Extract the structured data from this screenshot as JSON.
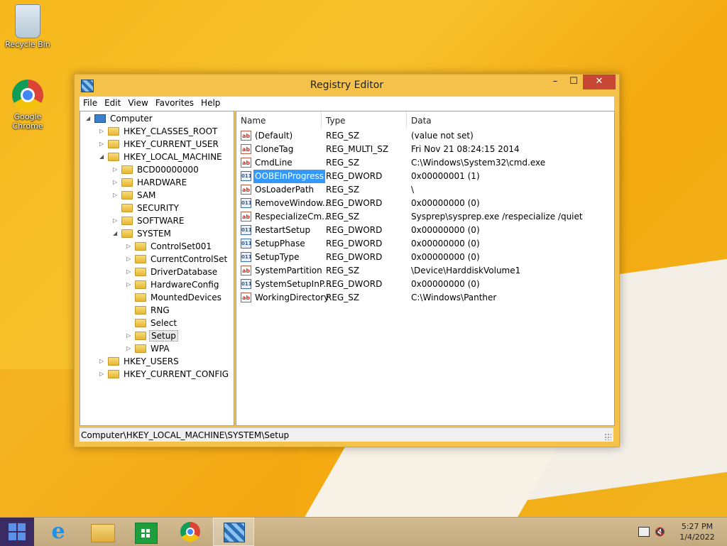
{
  "desktop": {
    "icons": [
      {
        "label": "Recycle Bin",
        "icon": "recycle-bin-icon"
      },
      {
        "label": "Google\nChrome",
        "icon": "chrome-icon"
      }
    ]
  },
  "window": {
    "title": "Registry Editor",
    "controls": {
      "minimize": "–",
      "maximize": "☐",
      "close": "✕"
    },
    "menu": [
      "File",
      "Edit",
      "View",
      "Favorites",
      "Help"
    ],
    "tree": [
      {
        "label": "Computer",
        "level": 0,
        "expander": "◢",
        "kind": "computer"
      },
      {
        "label": "HKEY_CLASSES_ROOT",
        "level": 1,
        "expander": "▷"
      },
      {
        "label": "HKEY_CURRENT_USER",
        "level": 1,
        "expander": "▷"
      },
      {
        "label": "HKEY_LOCAL_MACHINE",
        "level": 1,
        "expander": "◢"
      },
      {
        "label": "BCD00000000",
        "level": 2,
        "expander": "▷"
      },
      {
        "label": "HARDWARE",
        "level": 2,
        "expander": "▷"
      },
      {
        "label": "SAM",
        "level": 2,
        "expander": "▷"
      },
      {
        "label": "SECURITY",
        "level": 2,
        "expander": ""
      },
      {
        "label": "SOFTWARE",
        "level": 2,
        "expander": "▷"
      },
      {
        "label": "SYSTEM",
        "level": 2,
        "expander": "◢"
      },
      {
        "label": "ControlSet001",
        "level": 3,
        "expander": "▷"
      },
      {
        "label": "CurrentControlSet",
        "level": 3,
        "expander": "▷"
      },
      {
        "label": "DriverDatabase",
        "level": 3,
        "expander": "▷"
      },
      {
        "label": "HardwareConfig",
        "level": 3,
        "expander": "▷"
      },
      {
        "label": "MountedDevices",
        "level": 3,
        "expander": ""
      },
      {
        "label": "RNG",
        "level": 3,
        "expander": ""
      },
      {
        "label": "Select",
        "level": 3,
        "expander": ""
      },
      {
        "label": "Setup",
        "level": 3,
        "expander": "▷",
        "selected": true
      },
      {
        "label": "WPA",
        "level": 3,
        "expander": "▷"
      },
      {
        "label": "HKEY_USERS",
        "level": 1,
        "expander": "▷"
      },
      {
        "label": "HKEY_CURRENT_CONFIG",
        "level": 1,
        "expander": "▷"
      }
    ],
    "columns": {
      "name": "Name",
      "type": "Type",
      "data": "Data"
    },
    "values": [
      {
        "name": "(Default)",
        "type": "REG_SZ",
        "data": "(value not set)",
        "icon": "string-value-icon",
        "glyph": "ab"
      },
      {
        "name": "CloneTag",
        "type": "REG_MULTI_SZ",
        "data": "Fri Nov 21 08:24:15 2014",
        "icon": "string-value-icon",
        "glyph": "ab"
      },
      {
        "name": "CmdLine",
        "type": "REG_SZ",
        "data": "C:\\Windows\\System32\\cmd.exe",
        "icon": "string-value-icon",
        "glyph": "ab"
      },
      {
        "name": "OOBEInProgress",
        "type": "REG_DWORD",
        "data": "0x00000001 (1)",
        "icon": "binary-value-icon",
        "glyph": "011",
        "selected": true
      },
      {
        "name": "OsLoaderPath",
        "type": "REG_SZ",
        "data": "\\",
        "icon": "string-value-icon",
        "glyph": "ab"
      },
      {
        "name": "RemoveWindow...",
        "type": "REG_DWORD",
        "data": "0x00000000 (0)",
        "icon": "binary-value-icon",
        "glyph": "011"
      },
      {
        "name": "RespecializeCm...",
        "type": "REG_SZ",
        "data": "Sysprep\\sysprep.exe /respecialize /quiet",
        "icon": "string-value-icon",
        "glyph": "ab"
      },
      {
        "name": "RestartSetup",
        "type": "REG_DWORD",
        "data": "0x00000000 (0)",
        "icon": "binary-value-icon",
        "glyph": "011"
      },
      {
        "name": "SetupPhase",
        "type": "REG_DWORD",
        "data": "0x00000000 (0)",
        "icon": "binary-value-icon",
        "glyph": "011"
      },
      {
        "name": "SetupType",
        "type": "REG_DWORD",
        "data": "0x00000000 (0)",
        "icon": "binary-value-icon",
        "glyph": "011"
      },
      {
        "name": "SystemPartition",
        "type": "REG_SZ",
        "data": "\\Device\\HarddiskVolume1",
        "icon": "string-value-icon",
        "glyph": "ab"
      },
      {
        "name": "SystemSetupInP...",
        "type": "REG_DWORD",
        "data": "0x00000000 (0)",
        "icon": "binary-value-icon",
        "glyph": "011"
      },
      {
        "name": "WorkingDirectory",
        "type": "REG_SZ",
        "data": "C:\\Windows\\Panther",
        "icon": "string-value-icon",
        "glyph": "ab"
      }
    ],
    "status_path": "Computer\\HKEY_LOCAL_MACHINE\\SYSTEM\\Setup"
  },
  "taskbar": {
    "items": [
      "start-icon",
      "internet-explorer-icon",
      "file-explorer-icon",
      "store-icon",
      "chrome-icon",
      "registry-editor-icon"
    ],
    "ie_glyph": "e",
    "volume_glyph": "🔇",
    "clock": {
      "time": "5:27 PM",
      "date": "1/4/2022"
    }
  },
  "colors": {
    "selection": "#3399ff",
    "close_button": "#c74634",
    "window_frame": "#f4c24a"
  }
}
